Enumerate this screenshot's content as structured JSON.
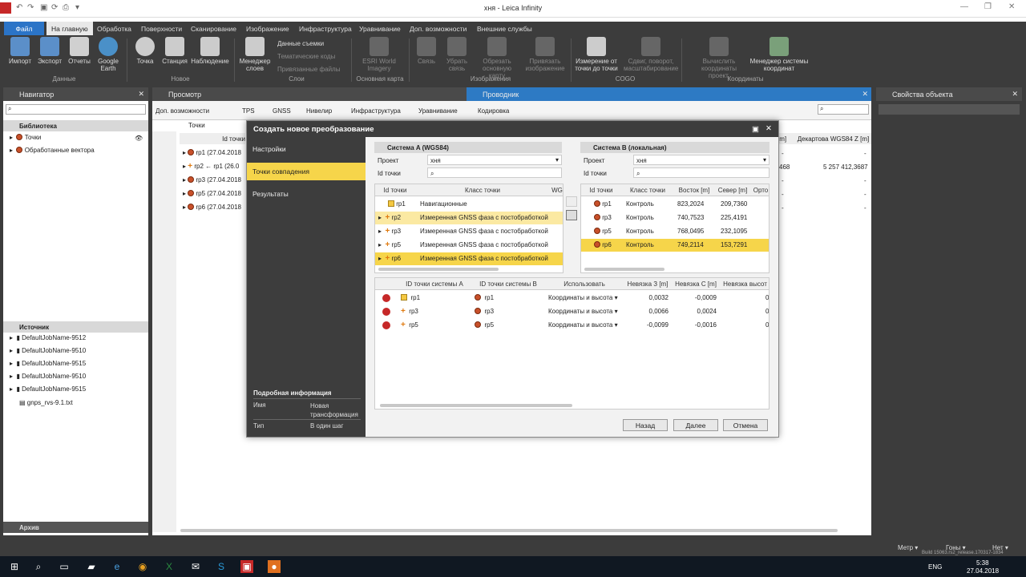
{
  "window": {
    "title": "хня - Leica Infinity"
  },
  "menu": {
    "file": "Файл",
    "items": [
      "На главную",
      "Обработка",
      "Поверхности",
      "Сканирование",
      "Изображение",
      "Инфраструктура",
      "Уравнивание",
      "Доп. возможности",
      "Внешние службы"
    ]
  },
  "ribbon": {
    "buttons": {
      "import": "Импорт",
      "export": "Экспорт",
      "reports": "Отчеты",
      "google_earth": "Google Earth",
      "point": "Точка",
      "station": "Станция",
      "observation": "Наблюдение",
      "layer_manager": "Менеджер слоев",
      "survey_data": "Данные съемки",
      "thematic_codes": "Тематические коды",
      "linked_files": "Привязанные файлы",
      "esri": "ESRI World Imagery",
      "link": "Связь",
      "remove_link": "Убрать связь",
      "crop_map": "Обрезать основную карту",
      "attach_image": "Привязать изображение",
      "measure": "Измерение от точки до точки",
      "shift": "Сдвиг, поворот, масштабирование",
      "compute_coords": "Вычислить координаты проект.",
      "cs_manager": "Менеджер системы координат"
    },
    "groups": {
      "data": "Данные",
      "new": "Новое",
      "layers": "Слои",
      "basemap": "Основная карта",
      "images": "Изображения",
      "cogo": "COGO",
      "coordinates": "Координаты"
    }
  },
  "navigator": {
    "title": "Навигатор",
    "library_header": "Библиотека",
    "library_items": [
      "Точки",
      "Обработанные вектора"
    ],
    "source_header": "Источник",
    "source_items": [
      "DefaultJobName-9512",
      "DefaultJobName-9510",
      "DefaultJobName-9515",
      "DefaultJobName-9510",
      "DefaultJobName-9515",
      "gnps_rvs-9.1.txt"
    ],
    "archive": "Архив"
  },
  "view": {
    "title": "Просмотр",
    "explorer": "Проводник",
    "tabs": [
      "Доп. возможности",
      "TPS",
      "GNSS",
      "Нивелир",
      "Инфраструктура",
      "Уравнивание",
      "Кодировка"
    ],
    "breadcrumb": "Точки",
    "col_id": "Id точки",
    "col_m": "[m]",
    "col_decart": "Декартова WGS84 Z [m]",
    "rows": [
      "rp1 (27.04.2018",
      "rp2 ← rp1 (26.0",
      "rp3 (27.04.2018",
      "rp5 (27.04.2018",
      "rp6 (27.04.2018"
    ],
    "vals_m": [
      "-",
      "468",
      "-",
      "-",
      "-"
    ],
    "vals_decart": [
      "-",
      "5 257 412,3687",
      "-",
      "-",
      "-"
    ]
  },
  "properties": {
    "title": "Свойства объекта"
  },
  "dialog": {
    "title": "Создать новое преобразование",
    "nav": [
      "Настройки",
      "Точки совпадения",
      "Результаты"
    ],
    "info_header": "Подробная информация",
    "info_name_label": "Имя",
    "info_name_value": "Новая трансформация",
    "info_type_label": "Тип",
    "info_type_value": "В один шаг",
    "sysA": {
      "header": "Система A (WGS84)",
      "project_label": "Проект",
      "project_value": "хня",
      "id_label": "Id точки",
      "cols": [
        "Id точки",
        "Класс точки",
        "WG"
      ],
      "rows": [
        {
          "id": "rp1",
          "cls": "Навигационные"
        },
        {
          "id": "rp2",
          "cls": "Измеренная GNSS фаза с постобработкой"
        },
        {
          "id": "rp3",
          "cls": "Измеренная GNSS фаза с постобработкой"
        },
        {
          "id": "rp5",
          "cls": "Измеренная GNSS фаза с постобработкой"
        },
        {
          "id": "rp6",
          "cls": "Измеренная GNSS фаза с постобработкой"
        }
      ]
    },
    "sysB": {
      "header": "Система B (локальная)",
      "project_label": "Проект",
      "project_value": "хня",
      "id_label": "Id точки",
      "cols": [
        "Id точки",
        "Класс точки",
        "Восток [m]",
        "Север [m]",
        "Орто"
      ],
      "rows": [
        {
          "id": "rp1",
          "cls": "Контроль",
          "e": "823,2024",
          "n": "209,7360"
        },
        {
          "id": "rp3",
          "cls": "Контроль",
          "e": "740,7523",
          "n": "225,4191"
        },
        {
          "id": "rp5",
          "cls": "Контроль",
          "e": "768,0495",
          "n": "232,1095"
        },
        {
          "id": "rp6",
          "cls": "Контроль",
          "e": "749,2114",
          "n": "153,7291"
        }
      ]
    },
    "matches": {
      "cols": [
        "ID точки системы A",
        "ID точки системы B",
        "Использовать",
        "Невязка З [m]",
        "Невязка С [m]",
        "Невязка высот"
      ],
      "rows": [
        {
          "a": "rp1",
          "b": "rp1",
          "use": "Координаты и высота",
          "dz": "0,0032",
          "dn": "-0,0009",
          "dh": "0"
        },
        {
          "a": "rp3",
          "b": "rp3",
          "use": "Координаты и высота",
          "dz": "0,0066",
          "dn": "0,0024",
          "dh": "0"
        },
        {
          "a": "rp5",
          "b": "rp5",
          "use": "Координаты и высота",
          "dz": "-0,0099",
          "dn": "-0,0016",
          "dh": "0"
        }
      ]
    },
    "buttons": {
      "back": "Назад",
      "next": "Далее",
      "cancel": "Отмена"
    }
  },
  "statusbar": {
    "unit": "Метр",
    "angle": "Гоны",
    "coord": "Нет",
    "build": "Build 15063.rs2_release.170317-1834"
  },
  "taskbar": {
    "lang": "ENG",
    "time": "5:38",
    "date": "27.04.2018"
  }
}
